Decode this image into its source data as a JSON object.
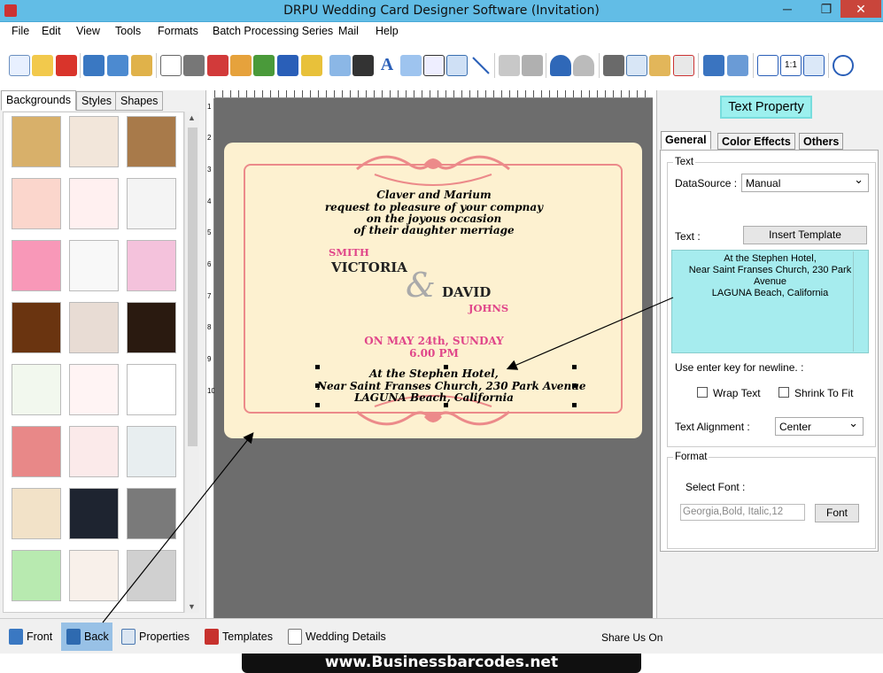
{
  "window": {
    "title": "DRPU Wedding Card Designer Software (Invitation)",
    "minimize": "─",
    "restore": "❐",
    "close": "✕"
  },
  "menu": [
    "File",
    "Edit",
    "View",
    "Tools",
    "Formats",
    "Batch Processing Series",
    "Mail",
    "Help"
  ],
  "left_panel": {
    "tabs": [
      "Backgrounds",
      "Styles",
      "Shapes"
    ],
    "active_tab": "Backgrounds"
  },
  "ruler": {
    "vertical_ticks": [
      "1",
      "2",
      "3",
      "4",
      "5",
      "6",
      "7",
      "8",
      "9",
      "10"
    ]
  },
  "card": {
    "line1": "Claver and Marium",
    "line2": "request to pleasure of your compnay",
    "line3": "on the joyous occasion",
    "line4": "of their daughter merriage",
    "bride_surname": "SMITH",
    "bride_name": "VICTORIA",
    "ampersand": "&",
    "groom_name": "DAVID",
    "groom_surname": "JOHNS",
    "date": "ON MAY 24th, SUNDAY",
    "time": "6.00 PM",
    "venue1": "At the Stephen Hotel,",
    "venue2": "Near Saint Franses Church, 230 Park Avenue",
    "venue3": "LAGUNA Beach, California"
  },
  "right_panel": {
    "header_button": "Text Property",
    "tabs": [
      "General",
      "Color Effects",
      "Others"
    ],
    "active_tab": "General",
    "text_group": "Text",
    "datasource_label": "DataSource :",
    "datasource_value": "Manual",
    "text_label": "Text :",
    "insert_template": "Insert Template",
    "text_value": "At the Stephen Hotel,\nNear Saint Franses Church, 230 Park Avenue\nLAGUNA Beach, California",
    "newline_hint": "Use enter key for newline. :",
    "wrap_text": "Wrap Text",
    "shrink_to_fit": "Shrink To Fit",
    "alignment_label": "Text Alignment :",
    "alignment_value": "Center",
    "format_group": "Format",
    "select_font_label": "Select Font :",
    "font_value": "Georgia,Bold, Italic,12",
    "font_button": "Font"
  },
  "bottom_tabs": [
    "Front",
    "Back",
    "Properties",
    "Templates",
    "Wedding Details"
  ],
  "active_bottom_tab": "Back",
  "share": "Share Us On",
  "watermark": "www.Businessbarcodes.net",
  "colors": {
    "titlebar": "#62bde6",
    "card_bg": "#fdf1d0",
    "card_frame": "#ec8a8a",
    "pink_text": "#e0468a",
    "canvas_bg": "#6d6d6d",
    "textarea_bg": "#a6ecee"
  }
}
